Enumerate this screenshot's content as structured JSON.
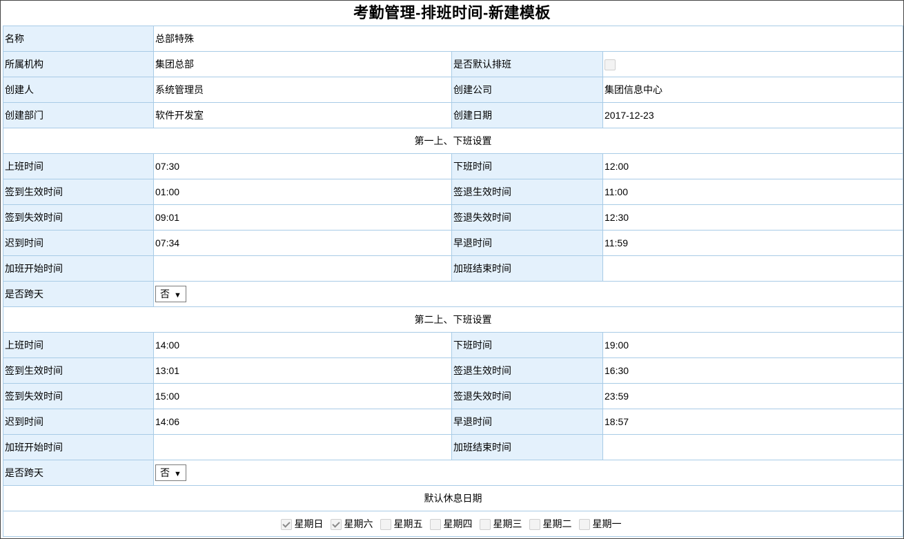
{
  "title": "考勤管理-排班时间-新建模板",
  "info": {
    "name_label": "名称",
    "name_value": "总部特殊",
    "org_label": "所属机构",
    "org_value": "集团总部",
    "default_label": "是否默认排班",
    "default_checked": false,
    "creator_label": "创建人",
    "creator_value": "系统管理员",
    "company_label": "创建公司",
    "company_value": "集团信息中心",
    "dept_label": "创建部门",
    "dept_value": "软件开发室",
    "date_label": "创建日期",
    "date_value": "2017-12-23"
  },
  "shift1": {
    "header": "第一上、下班设置",
    "on_label": "上班时间",
    "on_value": "07:30",
    "off_label": "下班时间",
    "off_value": "12:00",
    "signin_valid_label": "签到生效时间",
    "signin_valid_value": "01:00",
    "signout_valid_label": "签退生效时间",
    "signout_valid_value": "11:00",
    "signin_expire_label": "签到失效时间",
    "signin_expire_value": "09:01",
    "signout_expire_label": "签退失效时间",
    "signout_expire_value": "12:30",
    "late_label": "迟到时间",
    "late_value": "07:34",
    "early_label": "早退时间",
    "early_value": "11:59",
    "ot_start_label": "加班开始时间",
    "ot_start_value": "",
    "ot_end_label": "加班结束时间",
    "ot_end_value": "",
    "cross_day_label": "是否跨天",
    "cross_day_value": "否"
  },
  "shift2": {
    "header": "第二上、下班设置",
    "on_label": "上班时间",
    "on_value": "14:00",
    "off_label": "下班时间",
    "off_value": "19:00",
    "signin_valid_label": "签到生效时间",
    "signin_valid_value": "13:01",
    "signout_valid_label": "签退生效时间",
    "signout_valid_value": "16:30",
    "signin_expire_label": "签到失效时间",
    "signin_expire_value": "15:00",
    "signout_expire_label": "签退失效时间",
    "signout_expire_value": "23:59",
    "late_label": "迟到时间",
    "late_value": "14:06",
    "early_label": "早退时间",
    "early_value": "18:57",
    "ot_start_label": "加班开始时间",
    "ot_start_value": "",
    "ot_end_label": "加班结束时间",
    "ot_end_value": "",
    "cross_day_label": "是否跨天",
    "cross_day_value": "否"
  },
  "rest": {
    "header": "默认休息日期",
    "days": [
      {
        "label": "星期日",
        "checked": true
      },
      {
        "label": "星期六",
        "checked": true
      },
      {
        "label": "星期五",
        "checked": false
      },
      {
        "label": "星期四",
        "checked": false
      },
      {
        "label": "星期三",
        "checked": false
      },
      {
        "label": "星期二",
        "checked": false
      },
      {
        "label": "星期一",
        "checked": false
      }
    ]
  },
  "icons": {
    "dropdown": "triangle-down-icon",
    "checkbox": "checkbox-icon"
  },
  "colors": {
    "label_bg": "#e4f1fc",
    "border": "#a8cbe6"
  }
}
